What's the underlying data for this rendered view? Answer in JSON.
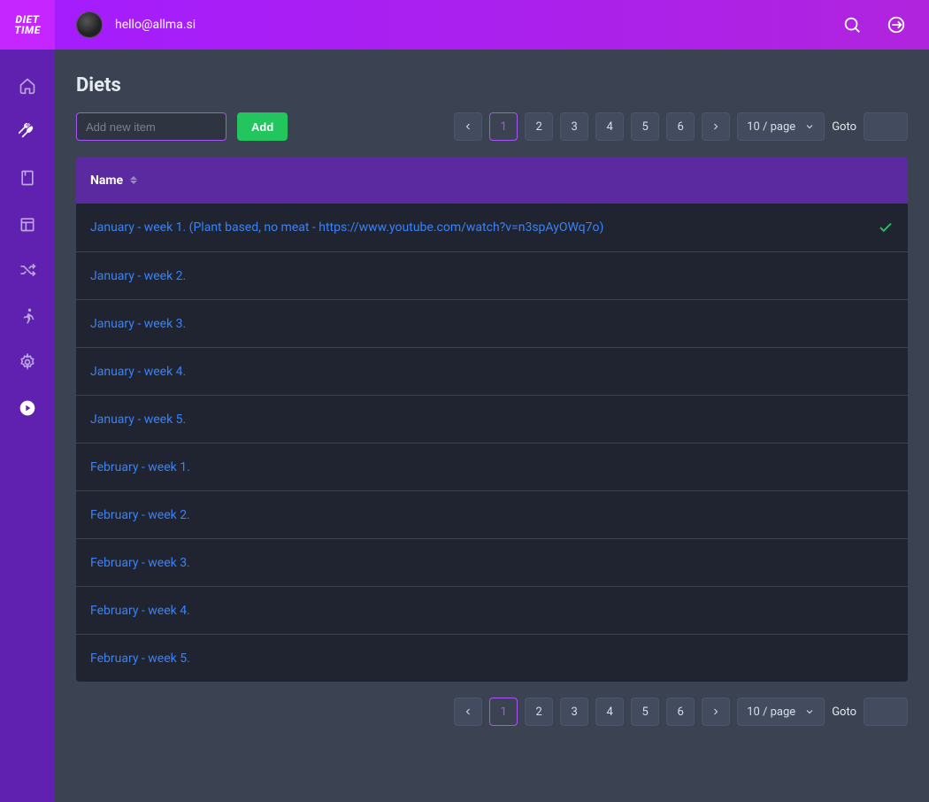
{
  "brand": {
    "line1": "DIET",
    "line2": "TIME"
  },
  "user": {
    "email": "hello@allma.si"
  },
  "page": {
    "title": "Diets"
  },
  "toolbar": {
    "add_placeholder": "Add new item",
    "add_button": "Add"
  },
  "pagination": {
    "pages": [
      "1",
      "2",
      "3",
      "4",
      "5",
      "6"
    ],
    "active": "1",
    "per_page": "10 / page",
    "goto_label": "Goto"
  },
  "table": {
    "header": {
      "name": "Name"
    },
    "rows": [
      {
        "name": "January - week 1. (Plant based, no meat - https://www.youtube.com/watch?v=n3spAyOWq7o)",
        "checked": true
      },
      {
        "name": "January - week 2.",
        "checked": false
      },
      {
        "name": "January - week 3.",
        "checked": false
      },
      {
        "name": "January - week 4.",
        "checked": false
      },
      {
        "name": "January - week 5.",
        "checked": false
      },
      {
        "name": "February - week 1.",
        "checked": false
      },
      {
        "name": "February - week 2.",
        "checked": false
      },
      {
        "name": "February - week 3.",
        "checked": false
      },
      {
        "name": "February - week 4.",
        "checked": false
      },
      {
        "name": "February - week 5.",
        "checked": false
      }
    ]
  },
  "sidebar": {
    "items": [
      {
        "icon": "home"
      },
      {
        "icon": "utensils",
        "active": true
      },
      {
        "icon": "book"
      },
      {
        "icon": "calendar"
      },
      {
        "icon": "shuffle"
      },
      {
        "icon": "run"
      },
      {
        "icon": "gear"
      },
      {
        "icon": "play"
      }
    ]
  }
}
